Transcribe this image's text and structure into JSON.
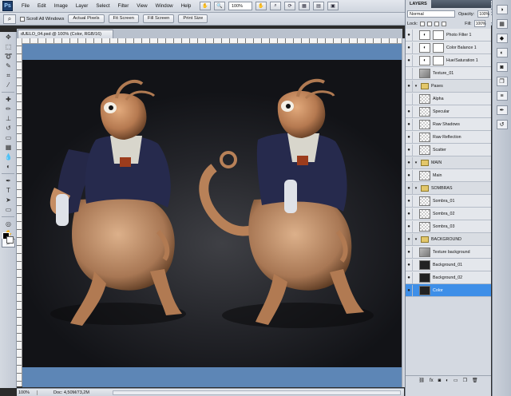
{
  "app": {
    "logo": "Ps"
  },
  "menu": [
    "File",
    "Edit",
    "Image",
    "Layer",
    "Select",
    "Filter",
    "View",
    "Window",
    "Help"
  ],
  "menubar_tools": {
    "zoom": "100%",
    "hand_icon": "hand-icon",
    "zoom_icon": "zoom-icon",
    "rotate_icon": "rotate-icon"
  },
  "options": {
    "scroll_all": "Scroll All Windows",
    "buttons": [
      "Actual Pixels",
      "Fit Screen",
      "Fill Screen",
      "Print Size"
    ]
  },
  "document": {
    "tab_title": "dUELO_04.psd @ 100% (Color, RGB/16)"
  },
  "status": {
    "zoom": "100%",
    "doc": "Doc: 4,50M/73,2M"
  },
  "layers_panel": {
    "tab": "LAYERS",
    "blend_mode": "Normal",
    "opacity_label": "Opacity:",
    "opacity": "100%",
    "lock_label": "Lock:",
    "fill_label": "Fill:",
    "fill": "100%",
    "layers": [
      {
        "name": "Photo Filter 1",
        "kind": "adj",
        "eye": true
      },
      {
        "name": "Color Balance 1",
        "kind": "adj",
        "eye": true
      },
      {
        "name": "Hue/Saturation 1",
        "kind": "adj",
        "eye": true
      },
      {
        "name": "Texture_01",
        "kind": "tex",
        "eye": false
      },
      {
        "name": "Pases",
        "kind": "group",
        "eye": true
      },
      {
        "name": "Alpha",
        "kind": "chk",
        "eye": false
      },
      {
        "name": "Specular",
        "kind": "chk",
        "eye": true
      },
      {
        "name": "Raw Shadows",
        "kind": "chk",
        "eye": true
      },
      {
        "name": "Raw Reflection",
        "kind": "chk",
        "eye": true
      },
      {
        "name": "Scatter",
        "kind": "chk",
        "eye": true
      },
      {
        "name": "MAIN",
        "kind": "group",
        "eye": true
      },
      {
        "name": "Main",
        "kind": "chk",
        "eye": true
      },
      {
        "name": "SOMBRAS",
        "kind": "group",
        "eye": true
      },
      {
        "name": "Sombra_01",
        "kind": "chk",
        "eye": true
      },
      {
        "name": "Sombra_02",
        "kind": "chk",
        "eye": true
      },
      {
        "name": "Sombra_03",
        "kind": "chk",
        "eye": true
      },
      {
        "name": "BACKGROUND",
        "kind": "group",
        "eye": true
      },
      {
        "name": "Texture background",
        "kind": "tex",
        "eye": true
      },
      {
        "name": "Background_01",
        "kind": "dark",
        "eye": true
      },
      {
        "name": "Background_02",
        "kind": "dark",
        "eye": true
      },
      {
        "name": "Color",
        "kind": "dark",
        "eye": true,
        "selected": true
      }
    ]
  }
}
